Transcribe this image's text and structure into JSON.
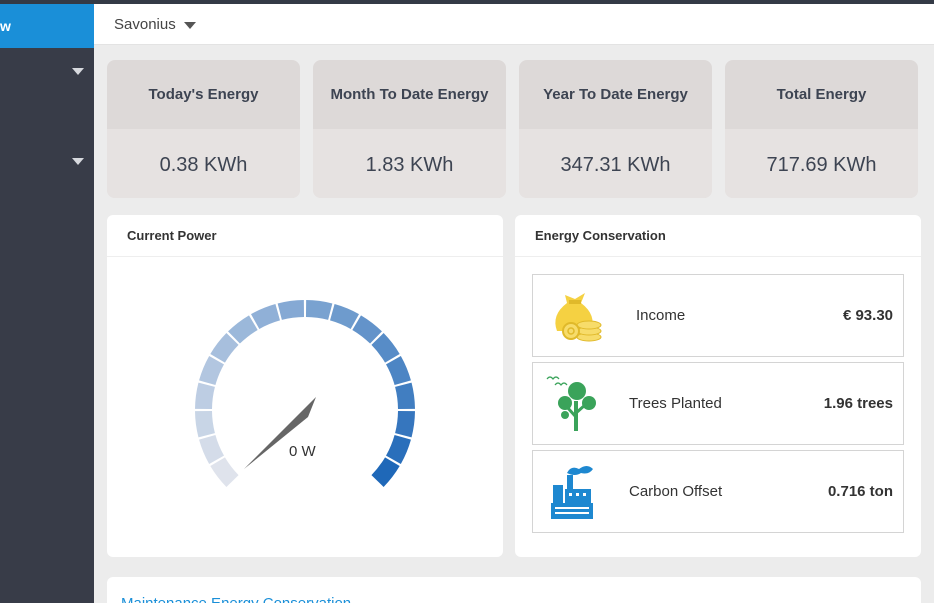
{
  "sidebar": {
    "active_label": "w"
  },
  "header": {
    "site_selector": "Savonius"
  },
  "kpis": [
    {
      "title": "Today's Energy",
      "value": "0.38 KWh"
    },
    {
      "title": "Month To Date Energy",
      "value": "1.83 KWh"
    },
    {
      "title": "Year To Date Energy",
      "value": "347.31 KWh"
    },
    {
      "title": "Total Energy",
      "value": "717.69 KWh"
    }
  ],
  "current_power": {
    "title": "Current Power",
    "value_label": "0 W",
    "value_fraction": 0.0
  },
  "energy_conservation": {
    "title": "Energy Conservation",
    "items": [
      {
        "label": "Income",
        "value": "€ 93.30",
        "icon": "money-bag-icon"
      },
      {
        "label": "Trees Planted",
        "value": "1.96 trees",
        "icon": "tree-icon"
      },
      {
        "label": "Carbon Offset",
        "value": "0.716 ton",
        "icon": "factory-icon"
      }
    ]
  },
  "bottom_section": {
    "title": "Maintenance Energy Conservation"
  },
  "colors": {
    "accent": "#1a8fd8",
    "sidebar": "#383c48",
    "gauge_light": "#dfe3ec",
    "gauge_dark": "#1f68b8",
    "tree_green": "#3aa35a",
    "bag_yellow": "#f5d142",
    "factory_blue": "#1e88d0"
  }
}
